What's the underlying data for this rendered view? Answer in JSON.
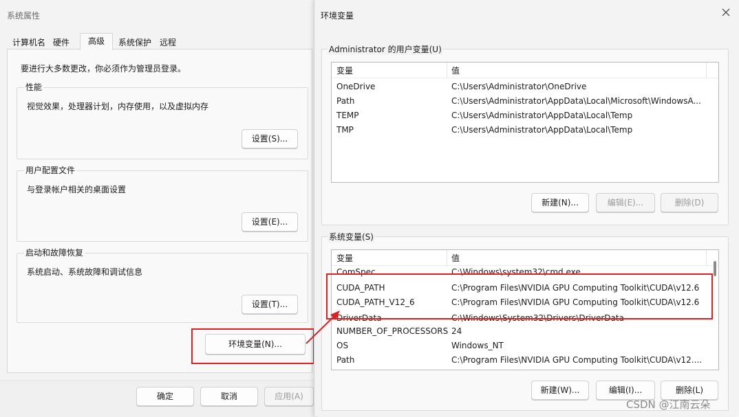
{
  "system_properties": {
    "title": "系统属性",
    "tabs": [
      {
        "label": "计算机名"
      },
      {
        "label": "硬件"
      },
      {
        "label": "高级"
      },
      {
        "label": "系统保护"
      },
      {
        "label": "远程"
      }
    ],
    "active_tab": "高级",
    "admin_note": "要进行大多数更改，你必须作为管理员登录。",
    "groups": [
      {
        "label": "性能",
        "description": "视觉效果，处理器计划，内存使用，以及虚拟内存",
        "button": "设置(S)..."
      },
      {
        "label": "用户配置文件",
        "description": "与登录帐户相关的桌面设置",
        "button": "设置(E)..."
      },
      {
        "label": "启动和故障恢复",
        "description": "系统启动、系统故障和调试信息",
        "button": "设置(T)..."
      }
    ],
    "env_button": "环境变量(N)...",
    "footer": {
      "ok": "确定",
      "cancel": "取消",
      "apply": "应用(A)"
    }
  },
  "environment_variables": {
    "title": "环境变量",
    "user_section_label": "Administrator 的用户变量(U)",
    "column_headers": {
      "name": "变量",
      "value": "值"
    },
    "user_vars": [
      {
        "name": "OneDrive",
        "value": "C:\\Users\\Administrator\\OneDrive"
      },
      {
        "name": "Path",
        "value": "C:\\Users\\Administrator\\AppData\\Local\\Microsoft\\WindowsA..."
      },
      {
        "name": "TEMP",
        "value": "C:\\Users\\Administrator\\AppData\\Local\\Temp"
      },
      {
        "name": "TMP",
        "value": "C:\\Users\\Administrator\\AppData\\Local\\Temp"
      }
    ],
    "user_buttons": {
      "new": "新建(N)...",
      "edit": "编辑(E)...",
      "delete": "删除(D)"
    },
    "system_section_label": "系统变量(S)",
    "system_vars": [
      {
        "name": "ComSpec",
        "value": "C:\\Windows\\system32\\cmd.exe"
      },
      {
        "name": "CUDA_PATH",
        "value": "C:\\Program Files\\NVIDIA GPU Computing Toolkit\\CUDA\\v12.6"
      },
      {
        "name": "CUDA_PATH_V12_6",
        "value": "C:\\Program Files\\NVIDIA GPU Computing Toolkit\\CUDA\\v12.6"
      },
      {
        "name": "DriverData",
        "value": "C:\\Windows\\System32\\Drivers\\DriverData"
      },
      {
        "name": "NUMBER_OF_PROCESSORS",
        "value": "24"
      },
      {
        "name": "OS",
        "value": "Windows_NT"
      },
      {
        "name": "Path",
        "value": "C:\\Program Files\\NVIDIA GPU Computing Toolkit\\CUDA\\v12...."
      }
    ],
    "system_buttons": {
      "new": "新建(W)...",
      "edit": "编辑(I)...",
      "delete": "删除(L)"
    }
  },
  "annotation_color": "#e02020",
  "watermark": "CSDN @江南云朵"
}
